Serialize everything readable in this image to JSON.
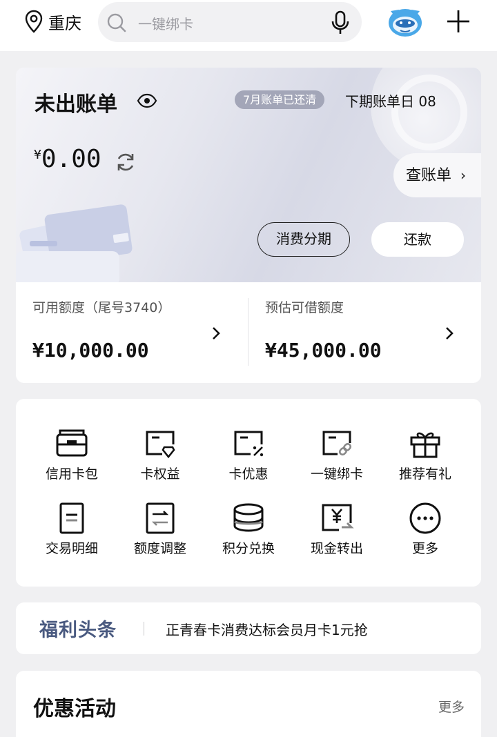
{
  "header": {
    "location": "重庆",
    "search_placeholder": "一键绑卡"
  },
  "bill": {
    "title": "未出账单",
    "status_badge": "7月账单已还清",
    "next_bill_date": "下期账单日  08",
    "currency": "¥",
    "amount": "0.00",
    "view_bill_label": "查账单",
    "installment_label": "消费分期",
    "repay_label": "还款"
  },
  "limits": {
    "available_label": "可用额度（尾号3740）",
    "available_value": "¥10,000.00",
    "loan_label": "预估可借额度",
    "loan_value": "¥45,000.00"
  },
  "quick_actions": [
    {
      "label": "信用卡包",
      "icon": "wallet-icon"
    },
    {
      "label": "卡权益",
      "icon": "card-benefit-icon"
    },
    {
      "label": "卡优惠",
      "icon": "card-discount-icon"
    },
    {
      "label": "一键绑卡",
      "icon": "card-link-icon"
    },
    {
      "label": "推荐有礼",
      "icon": "gift-icon"
    },
    {
      "label": "交易明细",
      "icon": "document-icon"
    },
    {
      "label": "额度调整",
      "icon": "adjust-icon"
    },
    {
      "label": "积分兑换",
      "icon": "coins-icon"
    },
    {
      "label": "现金转出",
      "icon": "cash-out-icon"
    },
    {
      "label": "更多",
      "icon": "more-icon"
    }
  ],
  "banner": {
    "logo_text": "福利头条",
    "headline": "正青春卡消费达标会员月卡1元抢"
  },
  "promotions": {
    "title": "优惠活动",
    "more_label": "更多"
  },
  "colors": {
    "badge_bg": "#a3a6b8",
    "banner_logo": "#4a5a80",
    "page_bg": "#f0f0f2"
  }
}
